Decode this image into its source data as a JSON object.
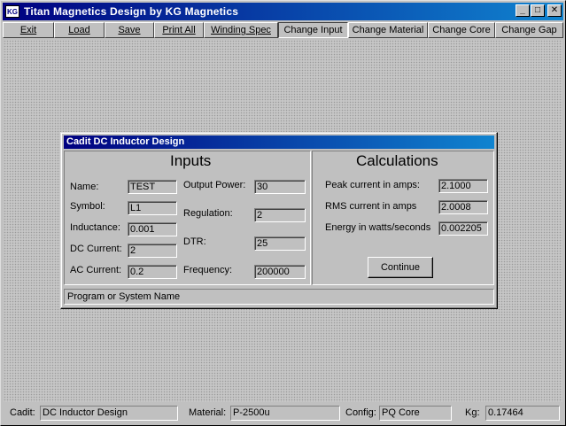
{
  "window": {
    "title": "Titan Magnetics Design by KG Magnetics",
    "icon_label": "KG",
    "minimize_glyph": "_",
    "maximize_glyph": "□",
    "close_glyph": "✕"
  },
  "toolbar": {
    "exit": "Exit",
    "load": "Load",
    "save": "Save",
    "print_all": "Print All",
    "winding_spec": "Winding Spec",
    "change_input": "Change Input",
    "change_material": "Change Material",
    "change_core": "Change Core",
    "change_gap": "Change Gap"
  },
  "dialog": {
    "title": "Cadit DC Inductor Design",
    "inputs": {
      "heading": "Inputs",
      "name_label": "Name:",
      "name_value": "TEST",
      "symbol_label": "Symbol:",
      "symbol_value": "L1",
      "inductance_label": "Inductance:",
      "inductance_value": "0.001",
      "dc_current_label": "DC Current:",
      "dc_current_value": "2",
      "ac_current_label": "AC Current:",
      "ac_current_value": "0.2",
      "output_power_label": "Output Power:",
      "output_power_value": "30",
      "regulation_label": "Regulation:",
      "regulation_value": "2",
      "dtr_label": "DTR:",
      "dtr_value": "25",
      "frequency_label": "Frequency:",
      "frequency_value": "200000"
    },
    "calculations": {
      "heading": "Calculations",
      "peak_label": "Peak current in amps:",
      "peak_value": "2.1000",
      "rms_label": "RMS current in amps",
      "rms_value": "2.0008",
      "energy_label": "Energy in watts/seconds",
      "energy_value": "0.002205"
    },
    "continue_label": "Continue",
    "status_text": "Program or System Name"
  },
  "statusbar": {
    "cadit_label": "Cadit:",
    "cadit_value": "DC Inductor Design",
    "material_label": "Material:",
    "material_value": "P-2500u",
    "config_label": "Config:",
    "config_value": "PQ Core",
    "kg_label": "Kg:",
    "kg_value": "0.17464"
  }
}
